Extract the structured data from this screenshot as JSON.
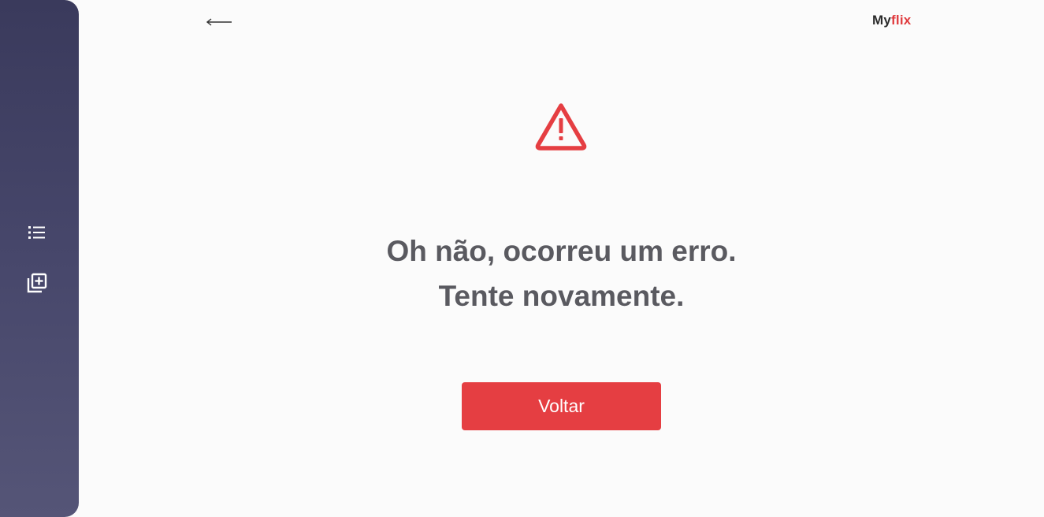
{
  "sidebar": {
    "items": [
      {
        "icon": "list-icon"
      },
      {
        "icon": "add-to-library-icon"
      }
    ]
  },
  "header": {
    "back_icon": "arrow-left-icon",
    "brand": {
      "part1": "My",
      "part2": "flix"
    }
  },
  "error": {
    "icon": "warning-triangle-icon",
    "line1": "Oh não, ocorreu um erro.",
    "line2": "Tente novamente.",
    "button_label": "Voltar"
  },
  "colors": {
    "accent": "#e53e42",
    "sidebar_top": "#3a3a5c",
    "sidebar_bottom": "#555577",
    "text": "#5a5a60"
  }
}
